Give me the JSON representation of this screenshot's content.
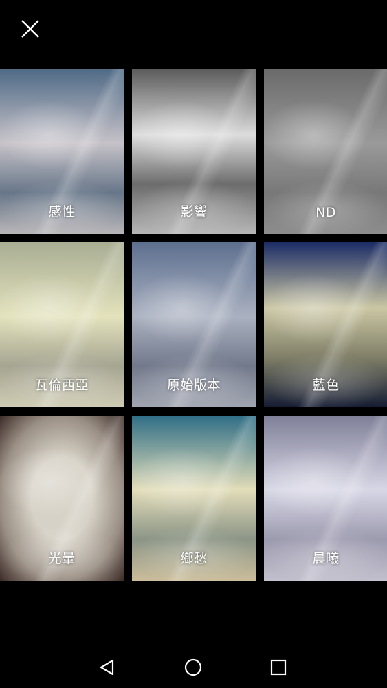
{
  "app": {
    "close_icon": "close-icon",
    "selected_color": "#1E88E5"
  },
  "filters": [
    {
      "label": "感性",
      "selected": false
    },
    {
      "label": "影響",
      "selected": false
    },
    {
      "label": "ND",
      "selected": false
    },
    {
      "label": "瓦倫西亞",
      "selected": false
    },
    {
      "label": "原始版本",
      "selected": false
    },
    {
      "label": "藍色",
      "selected": false
    },
    {
      "label": "光暈",
      "selected": true
    },
    {
      "label": "鄉愁",
      "selected": false
    },
    {
      "label": "晨曦",
      "selected": false
    }
  ],
  "navigation": {
    "back_icon": "back-triangle-icon",
    "home_icon": "home-circle-icon",
    "recent_icon": "recent-square-icon"
  }
}
